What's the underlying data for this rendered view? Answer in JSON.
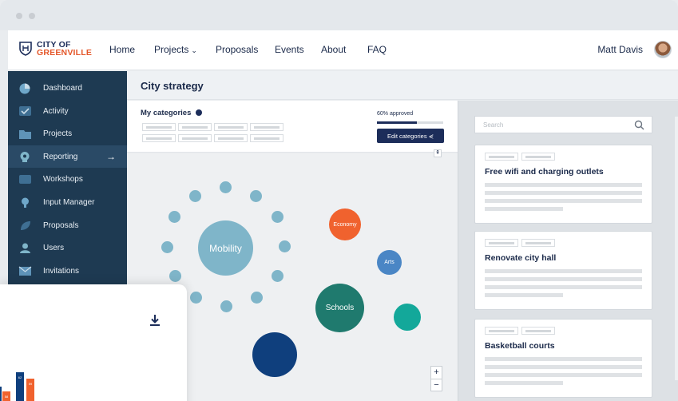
{
  "logo": {
    "line1": "CITY OF",
    "line2": "GREENVILLE"
  },
  "nav": {
    "items": [
      "Home",
      "Projects",
      "Proposals",
      "Events",
      "About",
      "FAQ"
    ],
    "user_name": "Matt Davis"
  },
  "sidebar": {
    "items": [
      {
        "label": "Dashboard",
        "icon": "pie-chart-icon"
      },
      {
        "label": "Activity",
        "icon": "check-icon"
      },
      {
        "label": "Projects",
        "icon": "folder-icon"
      },
      {
        "label": "Reporting",
        "icon": "head-icon"
      },
      {
        "label": "Workshops",
        "icon": "video-icon"
      },
      {
        "label": "Input Manager",
        "icon": "lightbulb-icon"
      },
      {
        "label": "Proposals",
        "icon": "leaf-icon"
      },
      {
        "label": "Users",
        "icon": "user-icon"
      },
      {
        "label": "Invitations",
        "icon": "mail-icon"
      }
    ],
    "active_index": 3
  },
  "main": {
    "title": "City strategy",
    "categories_title": "My categories",
    "approved_label": "60% approved",
    "approved_fraction": 0.6,
    "edit_button": "Edit categories"
  },
  "bubbles": {
    "mobility": "Mobility",
    "economy": "Economy",
    "arts": "Arts",
    "schools": "Schools",
    "colors": {
      "mobility": "#7fb5c9",
      "economy": "#f0622e",
      "arts": "#4a86c5",
      "schools": "#1f7a6e",
      "teal": "#13a89a",
      "navy": "#0f3f7d"
    }
  },
  "search": {
    "placeholder": "Search"
  },
  "cards": [
    {
      "title": "Free wifi and charging outlets"
    },
    {
      "title": "Renovate city hall"
    },
    {
      "title": "Basketball courts"
    }
  ],
  "overlay": {
    "bar_values": [
      "58",
      "62",
      "59"
    ]
  },
  "zoom": {
    "in": "+",
    "out": "−"
  }
}
